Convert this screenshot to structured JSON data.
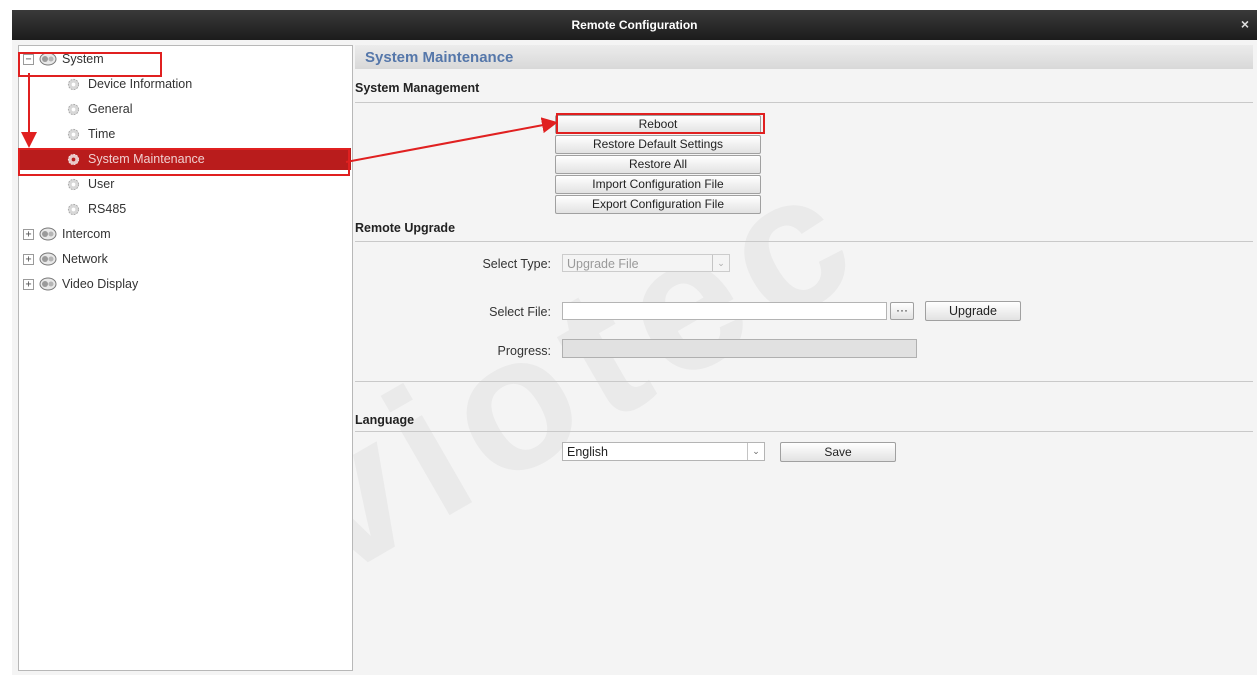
{
  "window": {
    "title": "Remote Configuration",
    "close_glyph": "×"
  },
  "tree": {
    "root": {
      "label": "System",
      "toggle": "−"
    },
    "children": [
      {
        "label": "Device Information"
      },
      {
        "label": "General"
      },
      {
        "label": "Time"
      },
      {
        "label": "System Maintenance",
        "selected": true
      },
      {
        "label": "User"
      },
      {
        "label": "RS485"
      }
    ],
    "others": [
      {
        "label": "Intercom",
        "toggle": "+"
      },
      {
        "label": "Network",
        "toggle": "+"
      },
      {
        "label": "Video Display",
        "toggle": "+"
      }
    ]
  },
  "panel": {
    "title": "System Maintenance",
    "system_management": {
      "heading": "System Management",
      "buttons": [
        "Reboot",
        "Restore Default Settings",
        "Restore All",
        "Import Configuration File",
        "Export Configuration File"
      ]
    },
    "remote_upgrade": {
      "heading": "Remote Upgrade",
      "select_type_label": "Select Type:",
      "select_type_value": "Upgrade File",
      "select_file_label": "Select File:",
      "select_file_value": "",
      "browse_label": "···",
      "upgrade_label": "Upgrade",
      "progress_label": "Progress:",
      "progress_value": 0
    },
    "language": {
      "heading": "Language",
      "value": "English",
      "save_label": "Save"
    }
  },
  "watermark": "viotec",
  "colors": {
    "highlight": "#e02020",
    "selected_row": "#b91c1c",
    "panel_title": "#5577aa"
  }
}
